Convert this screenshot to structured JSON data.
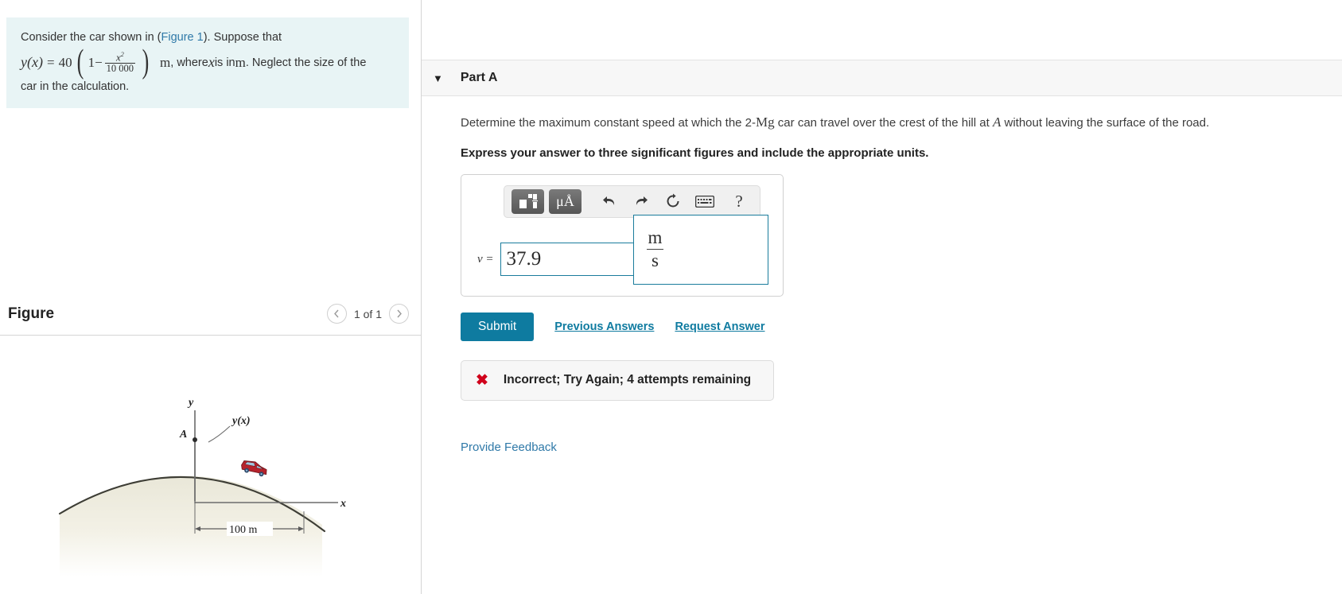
{
  "problem": {
    "intro_before_link": "Consider the car shown in (",
    "figure_link": "Figure 1",
    "intro_after_link": "). Suppose that",
    "equation": {
      "lhs": "y(x)",
      "equals": "=",
      "coefficient": "40",
      "paren_open": "(",
      "one_minus": "1−",
      "frac_num": "x",
      "frac_num_sup": "2",
      "frac_den": "10 000",
      "paren_close": ")",
      "unit": "m"
    },
    "tail_1": ", where ",
    "tail_var": "x",
    "tail_2": " is in ",
    "tail_unit": "m",
    "tail_3": ". Neglect the size of the",
    "last_line": "car in the calculation."
  },
  "figure": {
    "title": "Figure",
    "count_label": "1 of 1",
    "prev_icon": "chevron-left-icon",
    "next_icon": "chevron-right-icon",
    "diagram": {
      "y_axis_label": "y",
      "x_axis_label": "x",
      "curve_label": "y(x)",
      "point_label": "A",
      "dimension_label": "100 m"
    }
  },
  "part": {
    "caret_icon": "caret-down-icon",
    "title": "Part A",
    "question_pre": "Determine the maximum constant speed at which the 2-",
    "question_mg": "Mg",
    "question_mid": " car can travel over the crest of the hill at ",
    "question_point": "A",
    "question_post": " without leaving the surface of the road.",
    "instruction": "Express your answer to three significant figures and include the appropriate units."
  },
  "toolbar": {
    "template_icon": "math-template-icon",
    "units_icon": "micro-angstrom-units-icon",
    "units_label": "μÅ",
    "undo_icon": "undo-arrow-icon",
    "redo_icon": "redo-arrow-icon",
    "reset_icon": "reset-circular-arrow-icon",
    "keyboard_icon": "keyboard-icon",
    "help_icon": "question-mark-icon",
    "help_label": "?"
  },
  "answer": {
    "variable": "v =",
    "value": "37.9",
    "unit_numerator": "m",
    "unit_denominator": "s"
  },
  "actions": {
    "submit_label": "Submit",
    "previous_answers_label": "Previous Answers",
    "request_answer_label": "Request Answer"
  },
  "feedback": {
    "status_icon": "x-mark-icon",
    "status_glyph": "✖",
    "message": "Incorrect; Try Again; 4 attempts remaining",
    "provide_feedback_label": "Provide Feedback"
  },
  "colors": {
    "accent": "#0e7ba0",
    "problem_bg": "#e8f4f5",
    "error": "#d0021b",
    "field_border": "#1a7c9c",
    "link": "#2f79a8"
  }
}
